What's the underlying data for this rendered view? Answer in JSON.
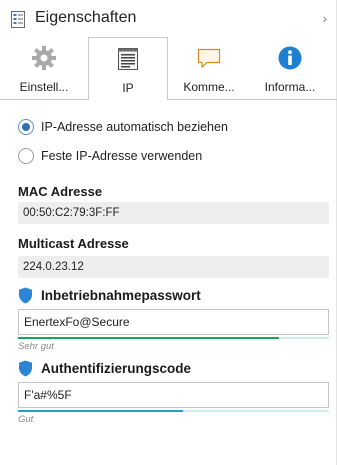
{
  "header": {
    "title": "Eigenschaften",
    "chevron": "›"
  },
  "tabs": [
    {
      "label": "Einstell...",
      "icon": "gear-icon",
      "active": false
    },
    {
      "label": "IP",
      "icon": "list-window-icon",
      "active": true
    },
    {
      "label": "Komme...",
      "icon": "comment-icon",
      "active": false
    },
    {
      "label": "Informa...",
      "icon": "info-icon",
      "active": false
    }
  ],
  "ip_mode": {
    "options": [
      {
        "label": "IP-Adresse automatisch beziehen",
        "checked": true
      },
      {
        "label": "Feste IP-Adresse verwenden",
        "checked": false
      }
    ]
  },
  "mac": {
    "label": "MAC Adresse",
    "value": "00:50:C2:79:3F:FF"
  },
  "multicast": {
    "label": "Multicast Adresse",
    "value": "224.0.23.12"
  },
  "commissioning_password": {
    "label": "Inbetriebnahmepasswort",
    "value": "EnertexFo@Secure",
    "strength_text": "Sehr gut",
    "strength_fraction": 0.84,
    "strength_color": "#1fa05a"
  },
  "auth_code": {
    "label": "Authentifizierungscode",
    "value": "F'a#%5F",
    "strength_text": "Gut",
    "strength_fraction": 0.53,
    "strength_color": "#2aa0c8"
  },
  "colors": {
    "accent": "#2f6db5",
    "shield": "#2b86d6"
  }
}
